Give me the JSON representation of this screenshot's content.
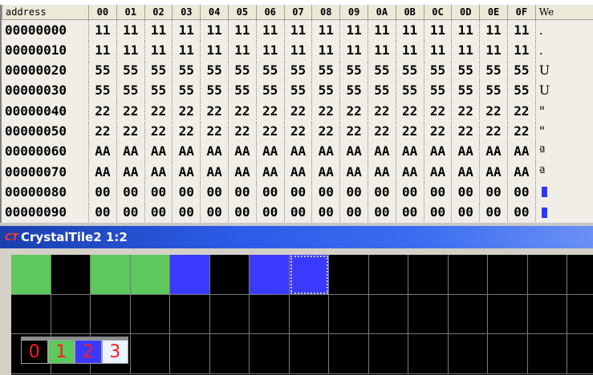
{
  "hex_view": {
    "header": {
      "address_label": "address",
      "columns": [
        "00",
        "01",
        "02",
        "03",
        "04",
        "05",
        "06",
        "07",
        "08",
        "09",
        "0A",
        "0B",
        "0C",
        "0D",
        "0E",
        "0F"
      ],
      "text_label": "We"
    },
    "rows": [
      {
        "address": "00000000",
        "bytes": [
          "11",
          "11",
          "11",
          "11",
          "11",
          "11",
          "11",
          "11",
          "11",
          "11",
          "11",
          "11",
          "11",
          "11",
          "11",
          "11"
        ],
        "text": "."
      },
      {
        "address": "00000010",
        "bytes": [
          "11",
          "11",
          "11",
          "11",
          "11",
          "11",
          "11",
          "11",
          "11",
          "11",
          "11",
          "11",
          "11",
          "11",
          "11",
          "11"
        ],
        "text": "."
      },
      {
        "address": "00000020",
        "bytes": [
          "55",
          "55",
          "55",
          "55",
          "55",
          "55",
          "55",
          "55",
          "55",
          "55",
          "55",
          "55",
          "55",
          "55",
          "55",
          "55"
        ],
        "text": "U"
      },
      {
        "address": "00000030",
        "bytes": [
          "55",
          "55",
          "55",
          "55",
          "55",
          "55",
          "55",
          "55",
          "55",
          "55",
          "55",
          "55",
          "55",
          "55",
          "55",
          "55"
        ],
        "text": "U"
      },
      {
        "address": "00000040",
        "bytes": [
          "22",
          "22",
          "22",
          "22",
          "22",
          "22",
          "22",
          "22",
          "22",
          "22",
          "22",
          "22",
          "22",
          "22",
          "22",
          "22"
        ],
        "text": "\""
      },
      {
        "address": "00000050",
        "bytes": [
          "22",
          "22",
          "22",
          "22",
          "22",
          "22",
          "22",
          "22",
          "22",
          "22",
          "22",
          "22",
          "22",
          "22",
          "22",
          "22"
        ],
        "text": "\""
      },
      {
        "address": "00000060",
        "bytes": [
          "AA",
          "AA",
          "AA",
          "AA",
          "AA",
          "AA",
          "AA",
          "AA",
          "AA",
          "AA",
          "AA",
          "AA",
          "AA",
          "AA",
          "AA",
          "AA"
        ],
        "text": "ª"
      },
      {
        "address": "00000070",
        "bytes": [
          "AA",
          "AA",
          "AA",
          "AA",
          "AA",
          "AA",
          "AA",
          "AA",
          "AA",
          "AA",
          "AA",
          "AA",
          "AA",
          "AA",
          "AA",
          "AA"
        ],
        "text": "ª"
      },
      {
        "address": "00000080",
        "bytes": [
          "00",
          "00",
          "00",
          "00",
          "00",
          "00",
          "00",
          "00",
          "00",
          "00",
          "00",
          "00",
          "00",
          "00",
          "00",
          "00"
        ],
        "text": "",
        "selected": true
      },
      {
        "address": "00000090",
        "bytes": [
          "00",
          "00",
          "00",
          "00",
          "00",
          "00",
          "00",
          "00",
          "00",
          "00",
          "00",
          "00",
          "00",
          "00",
          "00",
          "00"
        ],
        "text": "",
        "selected": true
      }
    ]
  },
  "tile_window": {
    "title": "CrystalTile2 1:2",
    "logo_text": "CT",
    "tiles_row0": [
      "green",
      "black",
      "green",
      "green",
      "blue",
      "black",
      "blue",
      "blue",
      "black",
      "black",
      "black",
      "black",
      "black",
      "black",
      "black"
    ],
    "selected_tile_index": 7,
    "colors": {
      "green": "#5dc85d",
      "blue": "#3a3aff",
      "black": "#000000"
    },
    "palette": [
      {
        "label": "0",
        "color": "#000000"
      },
      {
        "label": "1",
        "color": "#5dc85d"
      },
      {
        "label": "2",
        "color": "#3a3aff"
      },
      {
        "label": "3",
        "color": "#e8f4ff"
      }
    ]
  }
}
